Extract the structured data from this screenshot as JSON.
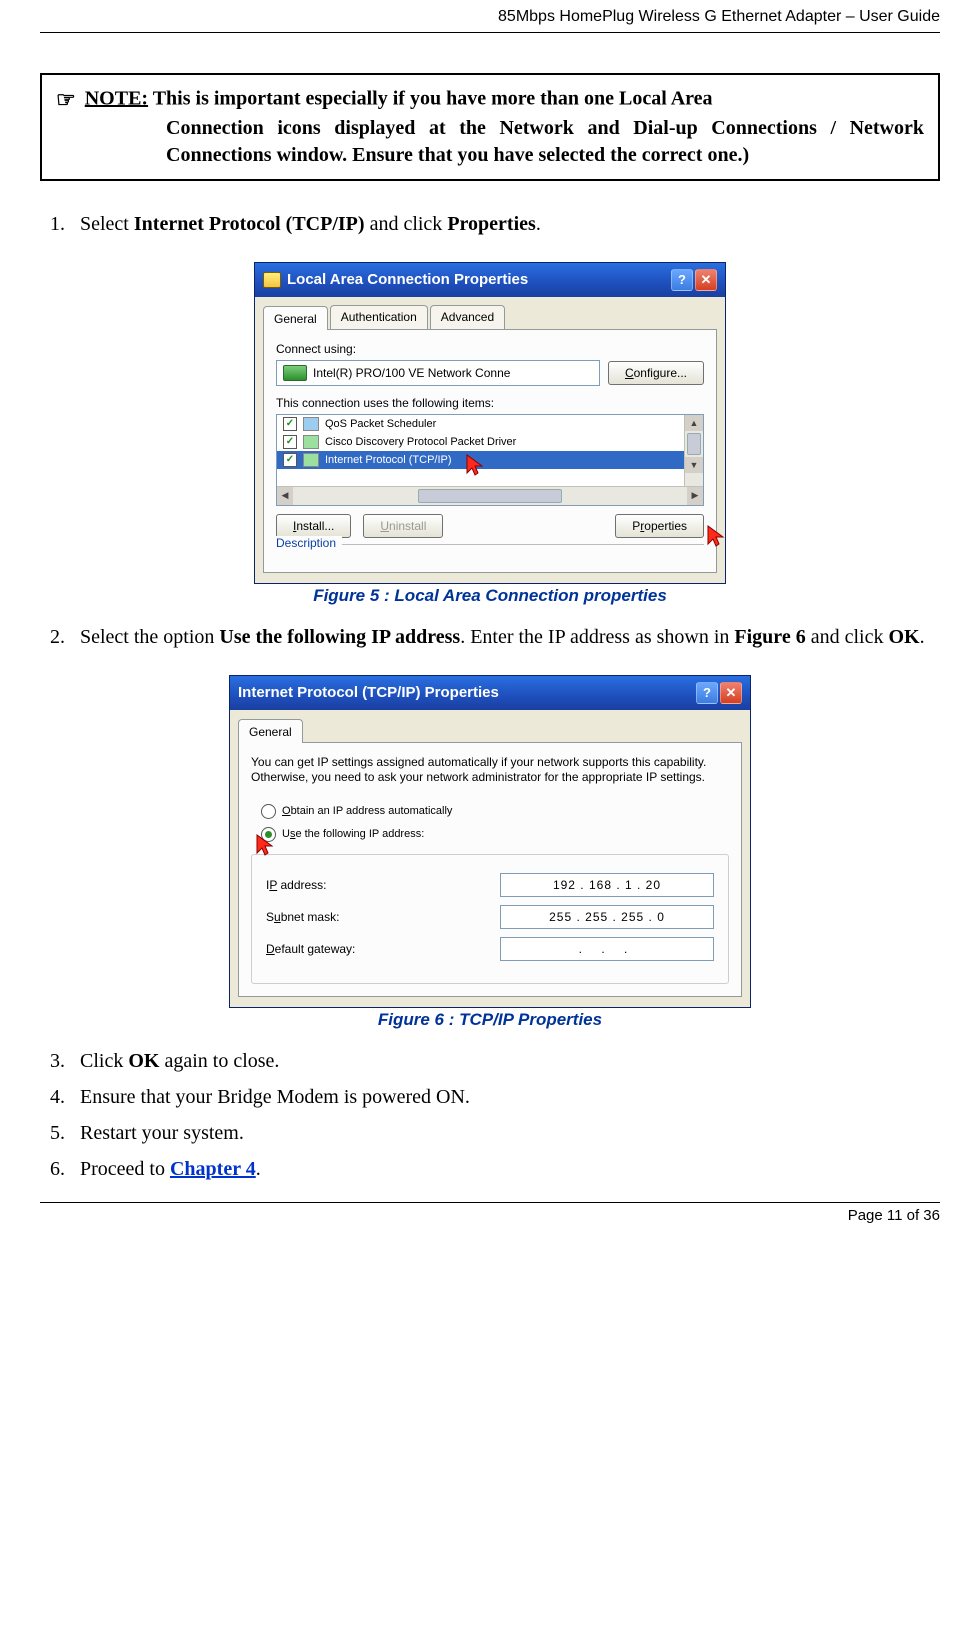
{
  "header": "85Mbps HomePlug Wireless G Ethernet Adapter – User Guide",
  "note": {
    "label": "NOTE:",
    "text": "This is important especially if you have more than one Local Area Connection icons displayed at the Network and Dial-up Connections / Network Connections window. Ensure that you have selected the correct one.)"
  },
  "steps": {
    "s1a": "Select ",
    "s1b": "Internet Protocol (TCP/IP)",
    "s1c": " and click ",
    "s1d": "Properties",
    "s1e": ".",
    "s2a": "Select the option ",
    "s2b": "Use the following IP address",
    "s2c": ". Enter the IP address as shown in ",
    "s2d": "Figure 6",
    "s2e": " and click ",
    "s2f": "OK",
    "s2g": ".",
    "s3a": "Click ",
    "s3b": "OK",
    "s3c": " again to close.",
    "s4": "Ensure that your Bridge Modem is powered ON.",
    "s5": "Restart your system.",
    "s6a": "Proceed to ",
    "s6b": "Chapter 4",
    "s6c": "."
  },
  "fig5": {
    "caption": "Figure 5 : Local Area Connection properties",
    "title": "Local Area Connection Properties",
    "tabs": {
      "general": "General",
      "auth": "Authentication",
      "adv": "Advanced"
    },
    "connect_using": "Connect using:",
    "adapter": "Intel(R) PRO/100 VE Network Conne",
    "configure": "Configure...",
    "uses_items": "This connection uses the following items:",
    "items": {
      "qos": "QoS Packet Scheduler",
      "cisco": "Cisco Discovery Protocol Packet Driver",
      "tcpip": "Internet Protocol (TCP/IP)"
    },
    "install": "Install...",
    "uninstall": "Uninstall",
    "properties": "Properties",
    "desc": "Description"
  },
  "fig6": {
    "caption": "Figure 6 : TCP/IP Properties",
    "title": "Internet Protocol (TCP/IP) Properties",
    "tab": "General",
    "para": "You can get IP settings assigned automatically if your network supports this capability. Otherwise, you need to ask your network administrator for the appropriate IP settings.",
    "radio_auto": "Obtain an IP address automatically",
    "radio_manual": "Use the following IP address:",
    "ip_label": "IP address:",
    "ip_value": "192 . 168 .  1   .  20",
    "subnet_label": "Subnet mask:",
    "subnet_value": "255 . 255 . 255 .  0",
    "gateway_label": "Default gateway:",
    "gateway_value": ".        .        ."
  },
  "footer": "Page 11 of 36"
}
